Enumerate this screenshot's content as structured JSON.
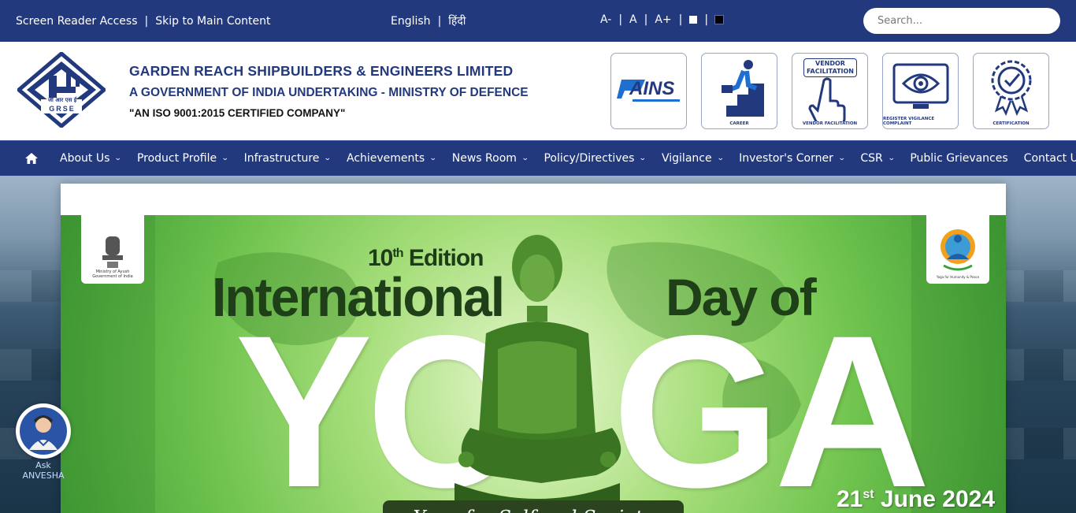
{
  "topbar": {
    "screen_reader": "Screen Reader Access",
    "sep": "|",
    "skip": "Skip to Main Content",
    "lang_en": "English",
    "lang_hi": "हिंदी",
    "font_dec": "A-",
    "font_norm": "A",
    "font_inc": "A+",
    "search_placeholder": "Search..."
  },
  "header": {
    "logo_text": "GRSE",
    "logo_hindi": "जी आर एस ई",
    "company_name": "GARDEN REACH SHIPBUILDERS & ENGINEERS LIMITED",
    "company_sub": "A GOVERNMENT OF INDIA UNDERTAKING - MINISTRY OF DEFENCE",
    "iso": "\"AN ISO 9001:2015 CERTIFIED COMPANY\""
  },
  "quick_links": [
    {
      "label": "CAINS",
      "caption": ""
    },
    {
      "label": "",
      "caption": "CAREER"
    },
    {
      "label": "VENDOR FACILITATION",
      "caption": "VENDOR FACILITATION"
    },
    {
      "label": "",
      "caption": "REGISTER VIGILANCE COMPLAINT"
    },
    {
      "label": "",
      "caption": "CERTIFICATION"
    }
  ],
  "nav": [
    "About Us",
    "Product Profile",
    "Infrastructure",
    "Achievements",
    "News Room",
    "Policy/Directives",
    "Vigilance",
    "Investor's Corner",
    "CSR",
    "Public Grievances",
    "Contact Us"
  ],
  "banner": {
    "ayush_line1": "Ministry of Ayush",
    "ayush_line2": "Government of India",
    "idy_caption": "Yoga for Humanity & Peace",
    "edition": "10",
    "edition_suffix": "th",
    "edition_word": "Edition",
    "intl": "International",
    "dayof": "Day of",
    "yo": "YO",
    "ga": "GA",
    "tagline": "Yoga for Self and Society",
    "date_day": "21",
    "date_suffix": "st",
    "date_rest": "June 2024"
  },
  "chatbot": {
    "label1": "Ask",
    "label2": "ANVESHA"
  },
  "colors": {
    "brand": "#23397d",
    "banner_green": "#6fc34e"
  }
}
